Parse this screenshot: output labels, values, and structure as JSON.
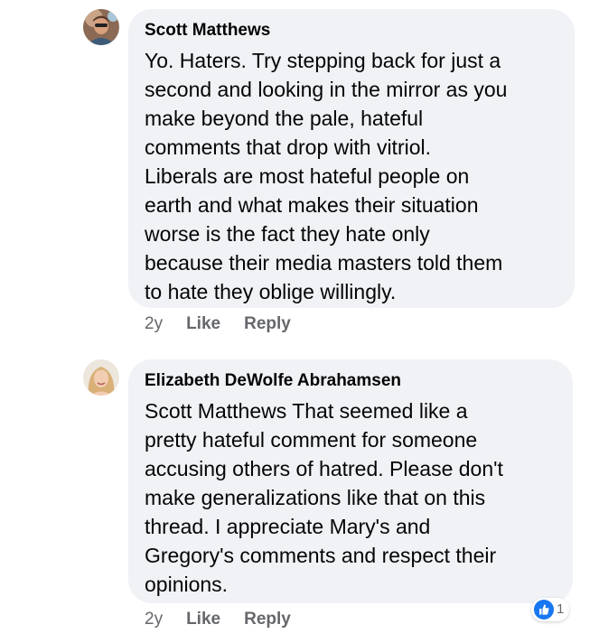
{
  "comments": [
    {
      "author": "Scott Matthews",
      "text": "Yo. Haters. Try stepping back for just a\nsecond and looking in the mirror as you\nmake beyond the pale, hateful\ncomments that drop with vitriol.\nLiberals are most hateful people on\nearth and what makes their situation\nworse is the fact they hate only\nbecause their media masters told them\nto hate they oblige willingly.",
      "time": "2y",
      "like_label": "Like",
      "reply_label": "Reply"
    },
    {
      "author": "Elizabeth DeWolfe Abrahamsen",
      "text": "Scott Matthews That seemed like a\npretty hateful comment for someone\naccusing others of hatred. Please don't\nmake generalizations like that on this\nthread. I appreciate Mary's and\nGregory's comments and respect their\nopinions.",
      "time": "2y",
      "like_label": "Like",
      "reply_label": "Reply",
      "reaction_count": "1"
    }
  ],
  "colors": {
    "bubble": "#f0f2f5",
    "meta": "#65676b",
    "like_blue": "#1877f2"
  }
}
